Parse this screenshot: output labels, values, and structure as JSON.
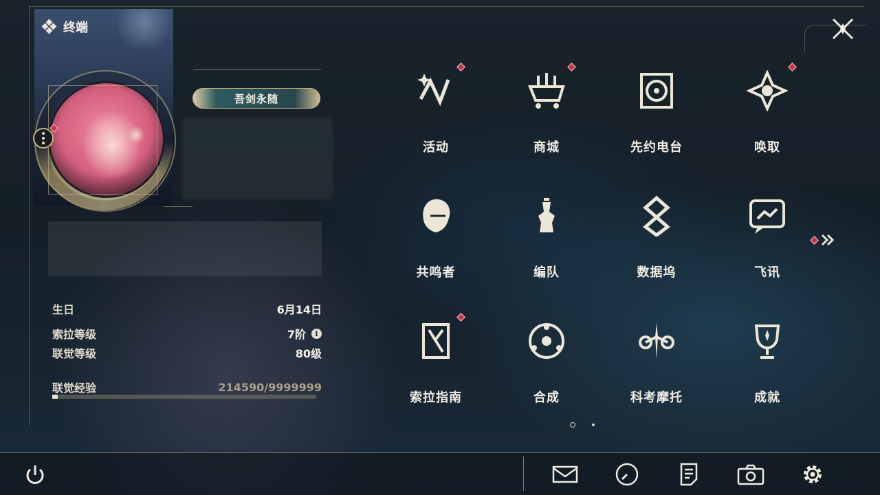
{
  "header": {
    "title": "终端"
  },
  "profile": {
    "title_badge": "吾剑永随"
  },
  "stats": {
    "birthday_label": "生日",
    "birthday_value": "6月14日",
    "sola_level_label": "索拉等级",
    "sola_level_value": "7阶",
    "union_level_label": "联觉等级",
    "union_level_value": "80级",
    "union_exp_label": "联觉经验",
    "union_exp_value": "214590/9999999",
    "union_exp_progress": 0.0215
  },
  "menu": {
    "items": [
      {
        "label": "活动",
        "icon": "activity-icon",
        "badge": true
      },
      {
        "label": "商城",
        "icon": "shop-icon",
        "badge": true
      },
      {
        "label": "先约电台",
        "icon": "radio-icon",
        "badge": false
      },
      {
        "label": "唤取",
        "icon": "convene-icon",
        "badge": true
      },
      {
        "label": "共鸣者",
        "icon": "resonator-icon",
        "badge": false
      },
      {
        "label": "编队",
        "icon": "team-icon",
        "badge": false
      },
      {
        "label": "数据坞",
        "icon": "data-bank-icon",
        "badge": false
      },
      {
        "label": "飞讯",
        "icon": "message-icon",
        "badge": false
      },
      {
        "label": "索拉指南",
        "icon": "guidebook-icon",
        "badge": true
      },
      {
        "label": "合成",
        "icon": "synthesis-icon",
        "badge": false
      },
      {
        "label": "科考摩托",
        "icon": "motorbike-icon",
        "badge": false
      },
      {
        "label": "成就",
        "icon": "achievement-icon",
        "badge": false
      }
    ],
    "pages": 2,
    "current_page": 1
  },
  "colors": {
    "accent": "#c9b47f",
    "badge": "#c8344a",
    "text": "#f2eee4"
  }
}
